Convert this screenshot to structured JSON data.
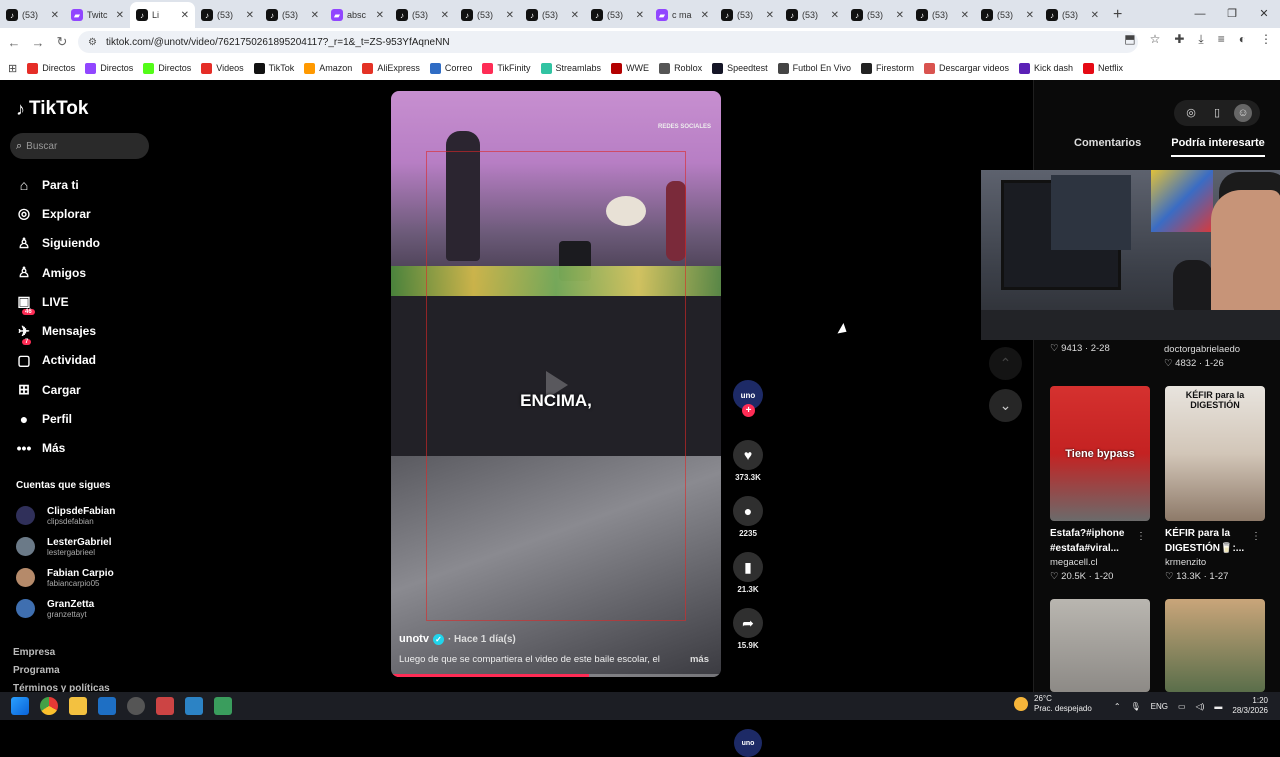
{
  "browser": {
    "tabs": [
      {
        "title": "(53)",
        "icon": "tiktok"
      },
      {
        "title": "Twitc",
        "icon": "twitch"
      },
      {
        "title": "Li",
        "icon": "tiktok",
        "active": true
      },
      {
        "title": "(53)",
        "icon": "tiktok"
      },
      {
        "title": "(53)",
        "icon": "tiktok"
      },
      {
        "title": "absc",
        "icon": "twitch"
      },
      {
        "title": "(53)",
        "icon": "tiktok"
      },
      {
        "title": "(53)",
        "icon": "tiktok"
      },
      {
        "title": "(53)",
        "icon": "tiktok"
      },
      {
        "title": "(53)",
        "icon": "tiktok"
      },
      {
        "title": "c ma",
        "icon": "twitch"
      },
      {
        "title": "(53)",
        "icon": "tiktok"
      },
      {
        "title": "(53)",
        "icon": "tiktok"
      },
      {
        "title": "(53)",
        "icon": "tiktok"
      },
      {
        "title": "(53)",
        "icon": "tiktok"
      },
      {
        "title": "(53)",
        "icon": "tiktok"
      },
      {
        "title": "(53)",
        "icon": "tiktok"
      }
    ],
    "new_tab": "+",
    "url": "tiktok.com/@unotv/video/7621750261895204117?_r=1&_t=ZS-953YfAqneNN",
    "bookmarks": [
      {
        "label": "Directos",
        "color": "#e52d27"
      },
      {
        "label": "Directos",
        "color": "#9146ff"
      },
      {
        "label": "Directos",
        "color": "#53fc18"
      },
      {
        "label": "Videos",
        "color": "#e52d27"
      },
      {
        "label": "TikTok",
        "color": "#111111"
      },
      {
        "label": "Amazon",
        "color": "#ff9900"
      },
      {
        "label": "AliExpress",
        "color": "#e43225"
      },
      {
        "label": "Correo",
        "color": "#2f6cc4"
      },
      {
        "label": "TikFinity",
        "color": "#fe2c55"
      },
      {
        "label": "Streamlabs",
        "color": "#31c3a2"
      },
      {
        "label": "WWE",
        "color": "#b30000"
      },
      {
        "label": "Roblox",
        "color": "#555555"
      },
      {
        "label": "Speedtest",
        "color": "#141526"
      },
      {
        "label": "Futbol En Vivo",
        "color": "#444444"
      },
      {
        "label": "Firestorm",
        "color": "#222222"
      },
      {
        "label": "Descargar videos",
        "color": "#d9534f"
      },
      {
        "label": "Kick dash",
        "color": "#5b21b6"
      },
      {
        "label": "Netflix",
        "color": "#e50914"
      }
    ]
  },
  "tiktok": {
    "logo": "TikTok",
    "search_placeholder": "Buscar",
    "nav": [
      {
        "label": "Para ti",
        "icon": "home-icon",
        "glyph": "⌂"
      },
      {
        "label": "Explorar",
        "icon": "compass-icon",
        "glyph": "◎"
      },
      {
        "label": "Siguiendo",
        "icon": "following-icon",
        "glyph": "♙"
      },
      {
        "label": "Amigos",
        "icon": "friends-icon",
        "glyph": "♙"
      },
      {
        "label": "LIVE",
        "icon": "live-icon",
        "glyph": "▣"
      },
      {
        "label": "Mensajes",
        "icon": "messages-icon",
        "glyph": "✈",
        "badge": "46"
      },
      {
        "label": "Actividad",
        "icon": "activity-icon",
        "glyph": "▢",
        "badge": "7"
      },
      {
        "label": "Cargar",
        "icon": "upload-icon",
        "glyph": "⊞"
      },
      {
        "label": "Perfil",
        "icon": "profile-icon",
        "glyph": "●"
      },
      {
        "label": "Más",
        "icon": "more-icon",
        "glyph": "•••"
      }
    ],
    "following_title": "Cuentas que sigues",
    "following": [
      {
        "name": "ClipsdeFabian",
        "user": "clipsdefabian"
      },
      {
        "name": "LesterGabriel",
        "user": "lestergabrieel"
      },
      {
        "name": "Fabian Carpio",
        "user": "fabiancarpio05"
      },
      {
        "name": "GranZetta",
        "user": "granzettayt"
      }
    ],
    "footer": [
      "Empresa",
      "Programa",
      "Términos y políticas"
    ],
    "video": {
      "caption_overlay": "ENCIMA,",
      "watermark": "REDES SOCIALES",
      "author": "unotv",
      "time": "· Hace 1 día(s)",
      "description": "Luego de que se compartiera el video de este baile escolar, el",
      "more": "más",
      "progress": 0.6,
      "avatar_text": "uno"
    },
    "actions": {
      "likes": "373.3K",
      "comments": "2235",
      "saves": "21.3K",
      "shares": "15.9K"
    },
    "right_tabs": [
      "Comentarios",
      "Podría interesarte"
    ],
    "cards": [
      {
        "title": "",
        "user": "",
        "stats": "♡ 9413 · 2-28"
      },
      {
        "title": "",
        "user": "doctorgabrielaedo",
        "stats": "♡ 4832 · 1-26"
      },
      {
        "title": "Estafa?#iphone #estafa#viral...",
        "user": "megacell.cl",
        "stats": "♡ 20.5K · 1-20",
        "thumb_text": "Tiene bypass"
      },
      {
        "title": "KÉFIR para la DIGESTIÓN🥛:...",
        "user": "krmenzito",
        "stats": "♡ 13.3K · 1-27",
        "thumb_text": "KÉFIR para la DIGESTIÓN"
      }
    ]
  },
  "taskbar": {
    "weather_temp": "26°C",
    "weather_desc": "Prac. despejado",
    "lang": "ENG",
    "time": "1:20",
    "date": "28/3/2026"
  }
}
